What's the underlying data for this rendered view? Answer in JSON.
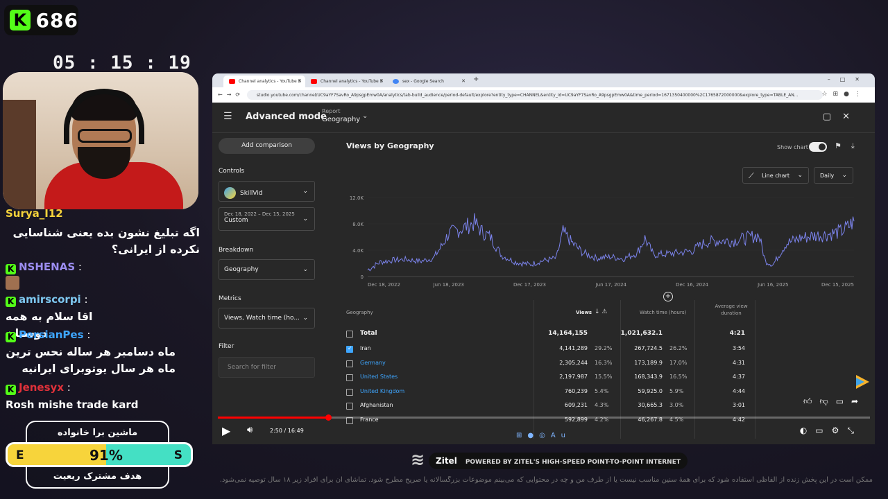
{
  "stream": {
    "viewer_count": "686",
    "timer": "05 : 15 : 19"
  },
  "chat": [
    {
      "user": "Surya_I12",
      "message": "",
      "user_color": "#f7d43b"
    },
    {
      "user": "",
      "message": "اگه تبلیغ نشون بده یعنی شناسایی نکرده از ایرانی؟",
      "user_color": ""
    },
    {
      "user": "NSHENAS",
      "message": ":",
      "user_color": "#9b8df0"
    },
    {
      "user": "amirscorpi",
      "message": ":",
      "user_color": "#7ec8f0"
    },
    {
      "user": "",
      "message": "اقا سلام به همه دوستان",
      "user_color": ""
    },
    {
      "user": "PersianPes",
      "message": ":",
      "user_color": "#3ea6ff"
    },
    {
      "user": "",
      "message": "ماه دسامبر هر ساله نحس ترین ماه هر سال یوتوبرای ایرانیه",
      "user_color": ""
    },
    {
      "user": "Jenesyx",
      "message": ":",
      "user_color": "#e0313a"
    },
    {
      "user": "",
      "message": "Rosh mishe trade kard",
      "user_color": ""
    }
  ],
  "goal": {
    "top_text": "ماشین برا خانواده",
    "bottom_text": "هدف مشترک ریعیت",
    "left_letter": "E",
    "right_letter": "S",
    "percent_label": "91%",
    "percent": 91
  },
  "browser": {
    "tabs": [
      {
        "title": "Channel analytics - YouTube S",
        "active": true,
        "favicon_color": "#ff0000"
      },
      {
        "title": "Channel analytics - YouTube S",
        "active": false,
        "favicon_color": "#ff0000"
      },
      {
        "title": "sex - Google Search",
        "active": false,
        "favicon_color": "#4285f4"
      }
    ],
    "url": "studio.youtube.com/channel/UC9aYF7SavRo_A9psgpEmw0A/analytics/tab-build_audience/period-default/explore?entity_type=CHANNEL&entity_id=UC9aYF7SavRo_A9psgpEmw0A&time_period=1671350400000%2C1765872000000&explore_type=TABLE_AN..."
  },
  "studio": {
    "mode_title": "Advanced mode",
    "report_label": "Report",
    "report_value": "Geography",
    "add_comparison": "Add comparison",
    "controls_label": "Controls",
    "channel_name": "SkillVid",
    "date_range_label": "Dec 18, 2022 – Dec 15, 2025",
    "date_range_value": "Custom",
    "breakdown_label": "Breakdown",
    "breakdown_value": "Geography",
    "metrics_label": "Metrics",
    "metrics_value": "Views, Watch time (ho...",
    "filter_label": "Filter",
    "filter_placeholder": "Search for filter",
    "chart_title": "Views by Geography",
    "show_chart_label": "Show chart",
    "chart_type": "Line chart",
    "period": "Daily"
  },
  "chart_data": {
    "type": "line",
    "title": "Views by Geography",
    "y_ticks": [
      "0",
      "4.0K",
      "8.0K",
      "12.0K"
    ],
    "ylim": [
      0,
      12000
    ],
    "x_ticks": [
      "Dec 18, 2022",
      "Jun 18, 2023",
      "Dec 17, 2023",
      "Jun 17, 2024",
      "Dec 16, 2024",
      "Jun 16, 2025",
      "Dec 15, 2025"
    ],
    "series": [
      {
        "color": "#7b83eb",
        "x": [
          "2022-12-18",
          "2023-01-15",
          "2023-02-15",
          "2023-03-15",
          "2023-04-15",
          "2023-05-15",
          "2023-06-01",
          "2023-06-18",
          "2023-07-15",
          "2023-08-15",
          "2023-09-01",
          "2023-09-20",
          "2023-10-15",
          "2023-11-15",
          "2023-12-17",
          "2024-01-15",
          "2024-02-15",
          "2024-03-01",
          "2024-03-20",
          "2024-04-15",
          "2024-05-15",
          "2024-06-17",
          "2024-07-15",
          "2024-08-15",
          "2024-09-01",
          "2024-09-20",
          "2024-10-15",
          "2024-11-15",
          "2024-12-16",
          "2025-01-15",
          "2025-02-15",
          "2025-03-15",
          "2025-04-15",
          "2025-05-15",
          "2025-05-30",
          "2025-06-16",
          "2025-07-15",
          "2025-08-15",
          "2025-09-15",
          "2025-10-15",
          "2025-11-15",
          "2025-12-01",
          "2025-12-15"
        ],
        "values": [
          1000,
          2200,
          2500,
          2600,
          2300,
          2800,
          4500,
          6500,
          7200,
          8200,
          6800,
          6000,
          3200,
          2200,
          1800,
          2400,
          2800,
          6800,
          5200,
          3600,
          2800,
          3000,
          2700,
          3600,
          5800,
          3300,
          3400,
          3600,
          3900,
          5200,
          5500,
          5400,
          5800,
          6300,
          2300,
          1800,
          5000,
          5800,
          6200,
          6400,
          6800,
          7500,
          8400
        ]
      }
    ]
  },
  "table": {
    "headers": {
      "geo": "Geography",
      "views": "Views",
      "watch_time": "Watch time (hours)",
      "avd": "Average view duration"
    },
    "total": {
      "label": "Total",
      "views": "14,164,155",
      "watch_time": "1,021,632.1",
      "avd": "4:21"
    },
    "rows": [
      {
        "geo": "Iran",
        "views": "4,141,289",
        "vpct": "29.2%",
        "wt": "267,724.5",
        "wpct": "26.2%",
        "avd": "3:54",
        "checked": true,
        "link": false
      },
      {
        "geo": "Germany",
        "views": "2,305,244",
        "vpct": "16.3%",
        "wt": "173,189.9",
        "wpct": "17.0%",
        "avd": "4:31",
        "checked": false,
        "link": true
      },
      {
        "geo": "United States",
        "views": "2,197,987",
        "vpct": "15.5%",
        "wt": "168,343.9",
        "wpct": "16.5%",
        "avd": "4:37",
        "checked": false,
        "link": true
      },
      {
        "geo": "United Kingdom",
        "views": "760,239",
        "vpct": "5.4%",
        "wt": "59,925.0",
        "wpct": "5.9%",
        "avd": "4:44",
        "checked": false,
        "link": true
      },
      {
        "geo": "Afghanistan",
        "views": "609,231",
        "vpct": "4.3%",
        "wt": "30,665.3",
        "wpct": "3.0%",
        "avd": "3:01",
        "checked": false,
        "link": false
      },
      {
        "geo": "France",
        "views": "592,899",
        "vpct": "4.2%",
        "wt": "46,267.8",
        "wpct": "4.5%",
        "avd": "4:42",
        "checked": false,
        "link": false
      }
    ]
  },
  "player": {
    "time": "2:50 / 16:49",
    "progress": 0.169
  },
  "sponsor": {
    "brand": "Zitel",
    "tagline": "POWERED BY ZITEL'S HIGH-SPEED POINT-TO-POINT INTERNET",
    "disclaimer": "ممکن است در این پخش زنده از الفاظی استفاده شود که برای همهٔ سنین مناسب نیست یا از طرف من و چه در محتوایی که می‌بینم موضوعات بزرگسالانه یا صریح مطرح شود. تماشای آن برای افراد زیر ۱۸ سال توصیه نمی‌شود."
  }
}
